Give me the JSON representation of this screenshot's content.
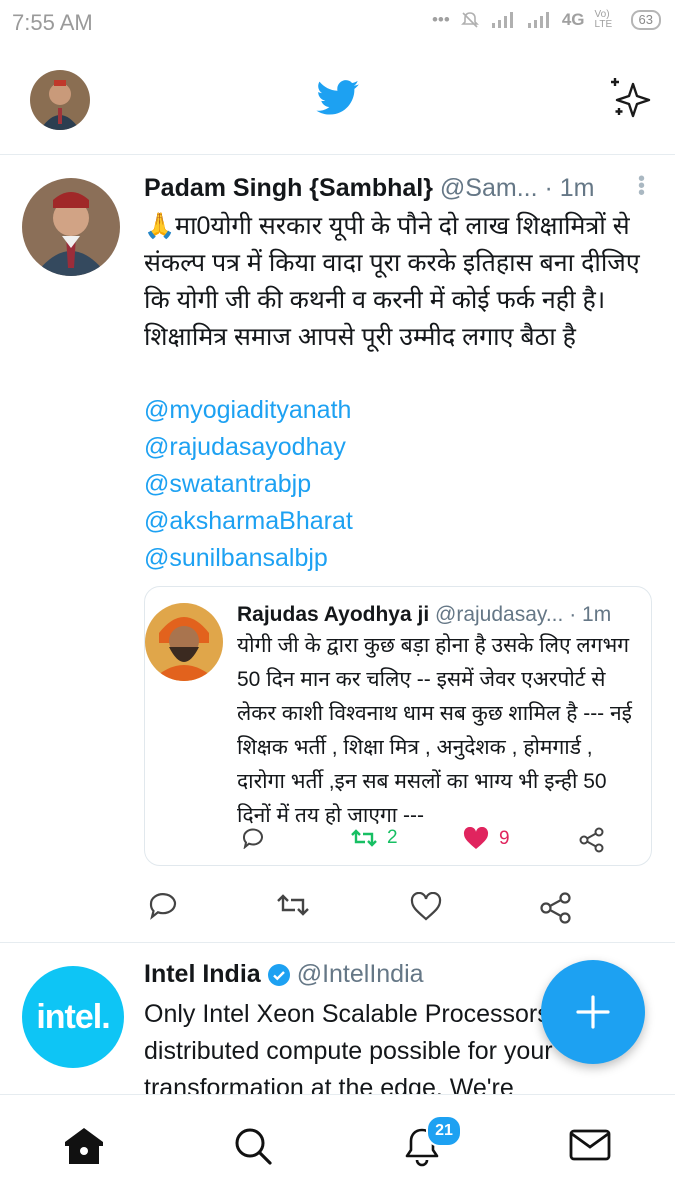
{
  "status_bar": {
    "time": "7:55 AM",
    "network": "4G",
    "volte": "Vo) LTE",
    "battery": "63"
  },
  "header": {
    "logo": "twitter-bird-icon",
    "sparkle": "sparkle-icon"
  },
  "tweet1": {
    "name": "Padam Singh {Sambhal}",
    "handle": "@Sam...",
    "time": "· 1m",
    "text": "🙏मा0योगी सरकार यूपी के पौने दो लाख शिक्षामित्रों से संकल्प पत्र में किया वादा पूरा करके इतिहास बना दीजिए कि योगी जी की कथनी व करनी में कोई फर्क नही है।शिक्षामित्र समाज आपसे पूरी उम्मीद लगाए बैठा है",
    "mentions": [
      "@myogiadityanath",
      "@rajudasayodhay",
      "@swatantrabjp",
      "@aksharmaBharat",
      "@sunilbansalbjp"
    ],
    "quote": {
      "name": "Rajudas Ayodhya ji",
      "handle": "@rajudasay...",
      "time": "· 1m",
      "text": "योगी जी के द्वारा  कुछ बड़ा होना है उसके लिए लगभग 50 दिन मान कर चलिए -- इसमें जेवर एअरपोर्ट  से लेकर काशी विश्वनाथ धाम सब कुछ शामिल है ---  नई शिक्षक भर्ती , शिक्षा मित्र , अनुदेशक , होमगार्ड , दारोगा भर्ती ,इन सब मसलों का भाग्य भी इन्ही 50 दिनों में तय हो जाएगा ---",
      "retweets": "2",
      "likes": "9"
    }
  },
  "tweet2": {
    "name": "Intel India",
    "handle": "@IntelIndia",
    "logo_text": "intel.",
    "text": "Only Intel Xeon Scalable Processors make distributed compute possible for your transformation at the edge. We're"
  },
  "nav": {
    "notifications_badge": "21"
  },
  "colors": {
    "accent": "#1da1f2",
    "like": "#e0245e",
    "retweet": "#17bf63"
  }
}
